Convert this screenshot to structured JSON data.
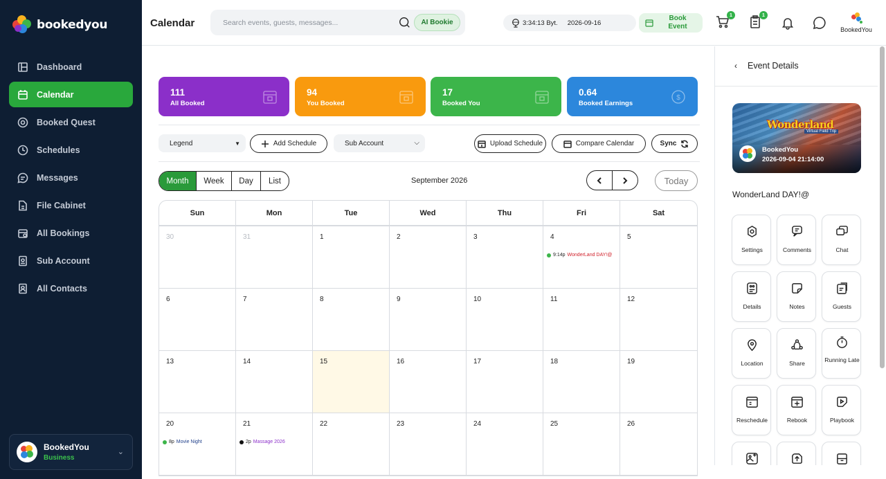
{
  "app": {
    "brand": "bookedyou"
  },
  "sidebar": {
    "items": [
      {
        "label": "Dashboard",
        "icon": "dashboard-icon",
        "active": false
      },
      {
        "label": "Calendar",
        "icon": "calendar-icon",
        "active": true
      },
      {
        "label": "Booked Quest",
        "icon": "compass-icon",
        "active": false
      },
      {
        "label": "Schedules",
        "icon": "clock-icon",
        "active": false
      },
      {
        "label": "Messages",
        "icon": "message-icon",
        "active": false
      },
      {
        "label": "File Cabinet",
        "icon": "file-icon",
        "active": false
      },
      {
        "label": "All Bookings",
        "icon": "bookings-icon",
        "active": false
      },
      {
        "label": "Sub Account",
        "icon": "sub-account-icon",
        "active": false
      },
      {
        "label": "All Contacts",
        "icon": "contacts-icon",
        "active": false
      }
    ],
    "account": {
      "name": "BookedYou",
      "role": "Business"
    }
  },
  "topbar": {
    "title": "Calendar",
    "search_placeholder": "Search events, guests, messages...",
    "ai_button": "AI Bookie",
    "time": "3:34:13 Byt.",
    "date": "2026-09-16",
    "book_event": "Book Event",
    "cart_badge": "1",
    "clipboard_badge": "1",
    "profile_label": "BookedYou"
  },
  "stats": [
    {
      "value": "111",
      "label": "All Booked",
      "color": "#8b2fc9"
    },
    {
      "value": "94",
      "label": "You Booked",
      "color": "#f99a0e"
    },
    {
      "value": "17",
      "label": "Booked You",
      "color": "#3cb54a"
    },
    {
      "value": "0.64",
      "label": "Booked Earnings",
      "color": "#2c87dc"
    }
  ],
  "toolbar": {
    "legend": "Legend",
    "add_schedule": "Add Schedule",
    "sub_account": "Sub Account",
    "upload_schedule": "Upload Schedule",
    "compare_calendar": "Compare Calendar",
    "sync": "Sync"
  },
  "calendar": {
    "views": [
      "Month",
      "Week",
      "Day",
      "List"
    ],
    "active_view": "Month",
    "month_label": "September 2026",
    "today_button": "Today",
    "weekdays": [
      "Sun",
      "Mon",
      "Tue",
      "Wed",
      "Thu",
      "Fri",
      "Sat"
    ],
    "rows": [
      [
        {
          "d": "30",
          "muted": true
        },
        {
          "d": "31",
          "muted": true
        },
        {
          "d": "1"
        },
        {
          "d": "2"
        },
        {
          "d": "3"
        },
        {
          "d": "4",
          "event": {
            "time": "9:14p",
            "title": "WonderLand DAY!@",
            "dot": "#3cb54a",
            "color": "#d0202a"
          }
        },
        {
          "d": "5"
        }
      ],
      [
        {
          "d": "6"
        },
        {
          "d": "7"
        },
        {
          "d": "8"
        },
        {
          "d": "9"
        },
        {
          "d": "10"
        },
        {
          "d": "11"
        },
        {
          "d": "12"
        }
      ],
      [
        {
          "d": "13"
        },
        {
          "d": "14"
        },
        {
          "d": "15",
          "today": true
        },
        {
          "d": "16"
        },
        {
          "d": "17"
        },
        {
          "d": "18"
        },
        {
          "d": "19"
        }
      ],
      [
        {
          "d": "20",
          "event": {
            "time": "8p",
            "title": "Movie Night",
            "dot": "#3cb54a",
            "color": "#1f3f8a"
          }
        },
        {
          "d": "21",
          "event": {
            "time": "2p",
            "title": "Massage 2026",
            "dot": "#111111",
            "color": "#8b2fc9"
          }
        },
        {
          "d": "22"
        },
        {
          "d": "23"
        },
        {
          "d": "24"
        },
        {
          "d": "25"
        },
        {
          "d": "26"
        }
      ]
    ]
  },
  "details": {
    "title": "Event Details",
    "poster_title": "Wonderland",
    "poster_subtitle": "Virtual Field Trip",
    "owner": "BookedYou",
    "datetime": "2026-09-04 21:14:00",
    "event_name": "WonderLand DAY!@",
    "actions": [
      {
        "label": "Settings",
        "icon": "settings-icon"
      },
      {
        "label": "Comments",
        "icon": "comments-icon"
      },
      {
        "label": "Chat",
        "icon": "chat-icon"
      },
      {
        "label": "Details",
        "icon": "details-icon"
      },
      {
        "label": "Notes",
        "icon": "notes-icon"
      },
      {
        "label": "Guests",
        "icon": "guests-icon"
      },
      {
        "label": "Location",
        "icon": "location-icon"
      },
      {
        "label": "Share",
        "icon": "share-icon"
      },
      {
        "label": "Running Late",
        "icon": "stopwatch-icon"
      },
      {
        "label": "Reschedule",
        "icon": "reschedule-icon"
      },
      {
        "label": "Rebook",
        "icon": "rebook-icon"
      },
      {
        "label": "Playbook",
        "icon": "playbook-icon"
      },
      {
        "label": "",
        "icon": "photo-icon"
      },
      {
        "label": "",
        "icon": "upload-icon"
      },
      {
        "label": "",
        "icon": "archive-icon"
      }
    ]
  }
}
